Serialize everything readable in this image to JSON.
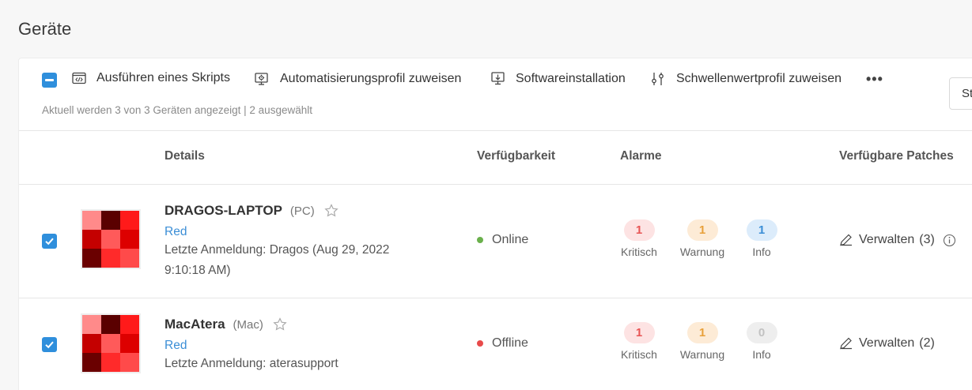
{
  "page": {
    "title": "Geräte"
  },
  "toolbar": {
    "run_script": "Ausführen eines Skripts",
    "automation_profile": "Automatisierungsprofil zuweisen",
    "software_install": "Softwareinstallation",
    "threshold_profile": "Schwellenwertprofil zuweisen",
    "more": "•••",
    "sort_label": "St"
  },
  "summary": "Aktuell werden 3 von 3 Geräten angezeigt | 2 ausgewählt",
  "columns": {
    "details": "Details",
    "availability": "Verfügbarkeit",
    "alarms": "Alarme",
    "patches": "Verfügbare Patches"
  },
  "alarm_labels": {
    "critical": "Kritisch",
    "warning": "Warnung",
    "info": "Info"
  },
  "devices": [
    {
      "name": "DRAGOS-LAPTOP",
      "type": "(PC)",
      "group": "Red",
      "last_login": "Letzte Anmeldung: Dragos (Aug 29, 2022 9:10:18 AM)",
      "status": "Online",
      "status_color": "#6ab04c",
      "alarms": {
        "critical": "1",
        "warning": "1",
        "info": "1"
      },
      "manage_label": "Verwalten",
      "patch_count": "(3)",
      "avatar_colors": [
        "#ff8a8a",
        "#5a0000",
        "#ff1a1a",
        "#c40000",
        "#ff5a5a",
        "#dd0000",
        "#6a0000",
        "#ff2a2a",
        "#ff4a4a"
      ]
    },
    {
      "name": "MacAtera",
      "type": "(Mac)",
      "group": "Red",
      "last_login": "Letzte Anmeldung: aterasupport",
      "status": "Offline",
      "status_color": "#e84a4a",
      "alarms": {
        "critical": "1",
        "warning": "1",
        "info": "0"
      },
      "manage_label": "Verwalten",
      "patch_count": "(2)",
      "avatar_colors": [
        "#ff8a8a",
        "#5a0000",
        "#ff1a1a",
        "#c40000",
        "#ff5a5a",
        "#dd0000",
        "#6a0000",
        "#ff2a2a",
        "#ff4a4a"
      ]
    }
  ],
  "colors": {
    "accent": "#2f8fdc",
    "critical_bg": "#fde3e3",
    "critical_fg": "#e85555",
    "warning_bg": "#fdebd6",
    "warning_fg": "#e8a03a",
    "info_bg": "#dcecfb",
    "info_fg": "#3b8ed6",
    "zero_bg": "#eeeeee",
    "zero_fg": "#c2c2c2"
  }
}
